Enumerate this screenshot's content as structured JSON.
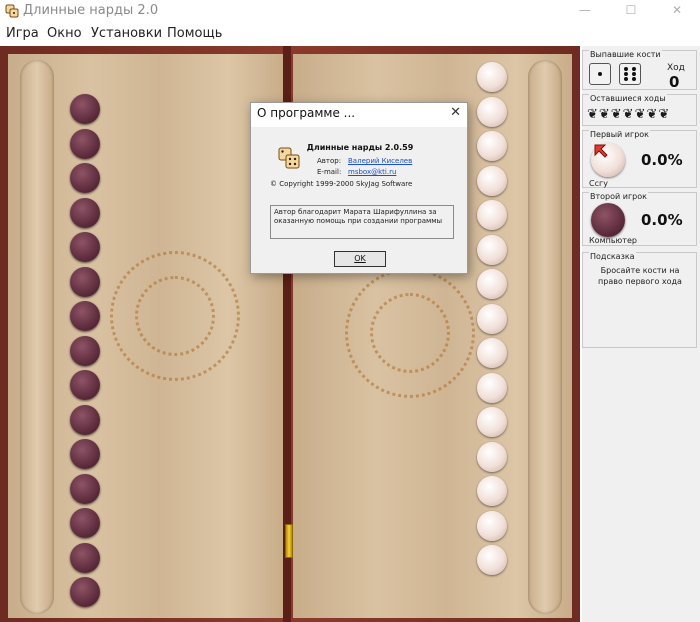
{
  "window": {
    "title": "Длинные нарды 2.0",
    "minimize": "—",
    "maximize": "☐",
    "close": "✕"
  },
  "menu": [
    "Игра",
    "Окно",
    "Установки",
    "Помощь"
  ],
  "board": {
    "left_dark_checkers": 15,
    "right_light_checkers": 15
  },
  "panel": {
    "dice": {
      "label": "Выпавшие кости",
      "die1": 1,
      "die2": 6,
      "move_label": "Ход",
      "move_value": "0"
    },
    "moves_left": {
      "label": "Оставшиеся ходы",
      "glyphs": "❦❦❦❦❦❦❦"
    },
    "player1": {
      "label": "Первый игрок",
      "percent": "0.0%",
      "name": "Ссгу"
    },
    "player2": {
      "label": "Второй игрок",
      "percent": "0.0%",
      "name": "Компьютер"
    },
    "hint": {
      "label": "Подсказка",
      "text": "Бросайте кости на право первого хода"
    }
  },
  "dialog": {
    "title": "О программе ...",
    "close": "✕",
    "app_name": "Длинные нарды 2.0.59",
    "author_label": "Автор:",
    "author_value": "Валерий Киселев",
    "email_label": "E-mail:",
    "email_value": "msbox@kti.ru",
    "copyright": "© Copyright 1999-2000 SkyJag Software",
    "memo": "Автор благодарит Марата Шарифуллина за оказанную помощь при создании программы",
    "ok": "OK"
  },
  "colors": {
    "board_wood": "#d9c2a2",
    "board_frame": "#8a3a2c",
    "dark_checker": "#5b2a3b",
    "light_checker": "#f1dfd8",
    "link": "#1a4fd6"
  }
}
